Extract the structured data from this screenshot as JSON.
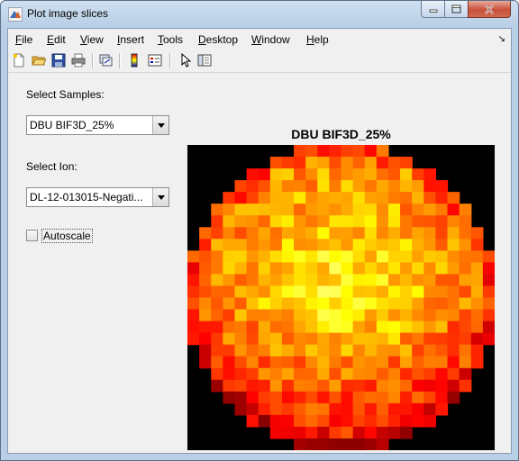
{
  "window": {
    "title": "Plot image slices"
  },
  "menubar": {
    "items": [
      {
        "label": "File",
        "mnemonic": "F",
        "rest": "ile"
      },
      {
        "label": "Edit",
        "mnemonic": "E",
        "rest": "dit"
      },
      {
        "label": "View",
        "mnemonic": "V",
        "rest": "iew"
      },
      {
        "label": "Insert",
        "mnemonic": "I",
        "rest": "nsert"
      },
      {
        "label": "Tools",
        "mnemonic": "T",
        "rest": "ools"
      },
      {
        "label": "Desktop",
        "mnemonic": "D",
        "rest": "esktop"
      },
      {
        "label": "Window",
        "mnemonic": "W",
        "rest": "indow"
      },
      {
        "label": "Help",
        "mnemonic": "H",
        "rest": "elp"
      }
    ]
  },
  "toolbar": {
    "icons": [
      "new-figure-icon",
      "open-file-icon",
      "save-icon",
      "print-icon",
      "link-plot-icon",
      "insert-colorbar-icon",
      "insert-legend-icon",
      "pointer-icon",
      "show-plot-tools-icon"
    ]
  },
  "controls": {
    "samples_label": "Select Samples:",
    "samples_value": "DBU BIF3D_25%",
    "ion_label": "Select Ion:",
    "ion_value": "DL-12-013015-Negati...",
    "autoscale_label": "Autoscale",
    "autoscale_checked": false
  },
  "plot": {
    "title": "DBU BIF3D_25%",
    "colormap": "hot",
    "grid_size": 26,
    "background": "#000000"
  }
}
